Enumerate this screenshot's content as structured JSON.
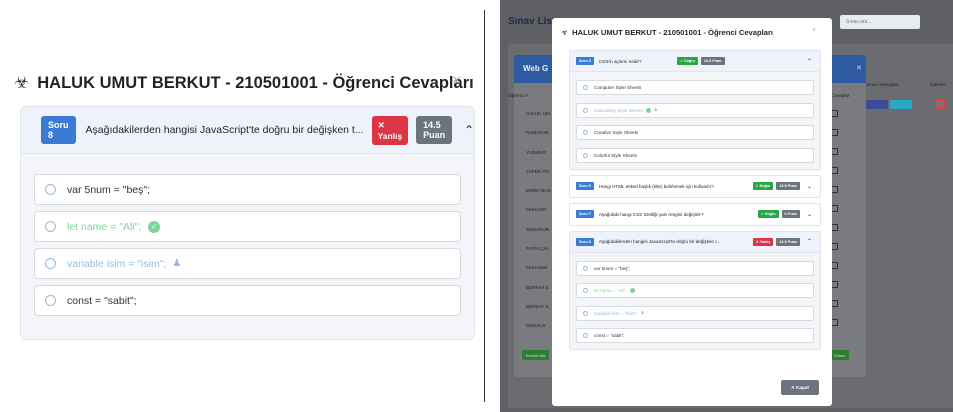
{
  "modal": {
    "title": "HALUK UMUT BERKUT - 210501001 - Öğrenci Cevapları",
    "title_icon": "user-graduate-icon",
    "close_symbol": "×",
    "close_label": "✕  Kapat"
  },
  "zoom": {
    "question_badge": "Soru 8",
    "question_text": "Aşağıdakilerden hangisi JavaScript'te doğru bir değişken t...",
    "status_badge": "✕ Yanlış",
    "points_badge": "14.5 Puan",
    "options": [
      {
        "text": "var 5num = \"beş\";",
        "state": "normal"
      },
      {
        "text": "let name = \"Ali\";",
        "state": "correct"
      },
      {
        "text": "variable isim = \"isim\";",
        "state": "selected"
      },
      {
        "text": "const = \"sabit\";",
        "state": "normal"
      }
    ]
  },
  "small": {
    "questions": [
      {
        "badge": "Soru 5",
        "text": "CSS'in açılımı nedir?",
        "status": "✓ Doğru",
        "status_type": "ok",
        "points": "14.5 Puan",
        "open": true,
        "options": [
          {
            "text": "Computer Style Sheets",
            "state": "normal"
          },
          {
            "text": "Cascading Style Sheets",
            "state": "correct-selected"
          },
          {
            "text": "Creative Style Sheets",
            "state": "normal"
          },
          {
            "text": "Colorful Style Sheets",
            "state": "normal"
          }
        ]
      },
      {
        "badge": "Soru 6",
        "text": "Hangi HTML etiketi başlık (title) belirlemek için kullanılır?",
        "status": "✓ Doğru",
        "status_type": "ok",
        "points": "14.5 Puan",
        "open": false
      },
      {
        "badge": "Soru 7",
        "text": "Aşağıdaki hangi CSS özelliği yazı rengini değiştirir?",
        "status": "✓ Doğru",
        "status_type": "ok",
        "points": "6 Puan",
        "open": false
      },
      {
        "badge": "Soru 8",
        "text": "Aşağıdakilerden hangisi JavaScript'te doğru bir değişken t...",
        "status": "✕ Yanlış",
        "status_type": "wrong",
        "points": "14.5 Puan",
        "open": true,
        "options": [
          {
            "text": "var 5num = \"beş\";",
            "state": "normal"
          },
          {
            "text": "let name = \"Ali\";",
            "state": "correct"
          },
          {
            "text": "variable isim = \"isim\";",
            "state": "selected"
          },
          {
            "text": "const = \"sabit\";",
            "state": "normal"
          }
        ]
      }
    ]
  },
  "background": {
    "page_title": "Sınav List",
    "search_placeholder": "Sınav ara...",
    "modal_title": "Web G",
    "col_student": "Öğrenci A",
    "col_exams": "Sınav Sonuçları",
    "col_actions": "İşlemler",
    "col_answers": "Cevaplar",
    "students": [
      "HALUK UM",
      "RAMAZAN",
      "YAĞMUR",
      "ZAFER PO",
      "EMRE MUS",
      "MUHARR",
      "SEMANUR",
      "FATİH ÇAL",
      "MUHAMM",
      "BERKAY E",
      "BERKAY S",
      "DONALD"
    ],
    "excel_button": "Excel'e Akt",
    "green_button": "Sınavı"
  },
  "colors": {
    "primary": "#3a7bd5",
    "success": "#28a745",
    "danger": "#dc3545",
    "secondary": "#6c757d",
    "correct_text": "#7fd39b",
    "selected_text": "#9ab8de"
  }
}
